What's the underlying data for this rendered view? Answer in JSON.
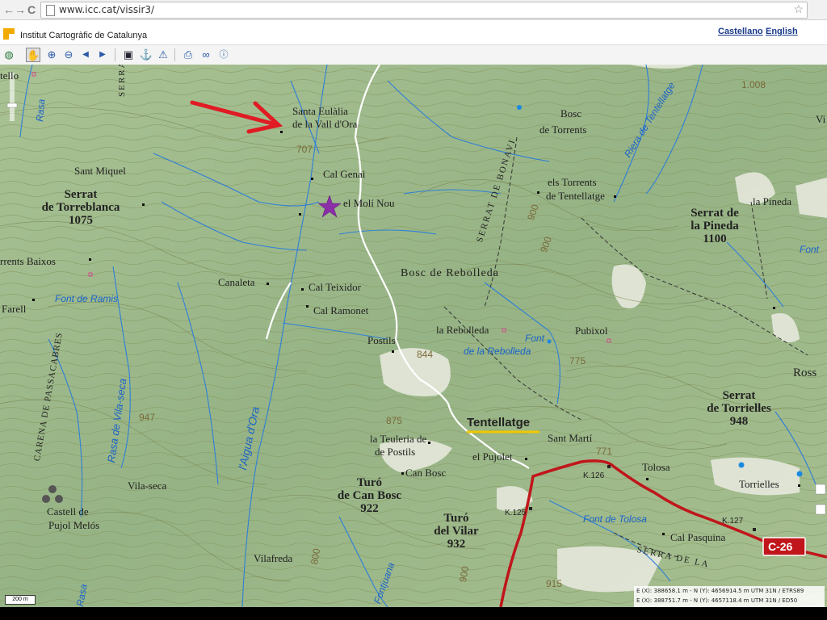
{
  "browser": {
    "back": "←",
    "forward": "→",
    "reload": "C",
    "url": "www.icc.cat/vissir3/",
    "star": "☆"
  },
  "header": {
    "title": "Institut Cartogràfic de Catalunya",
    "lang_es": "Castellano",
    "lang_en": "English"
  },
  "toolbar": {
    "icons": [
      "globe-icon",
      "hand-icon",
      "zoom-in-icon",
      "zoom-out-icon",
      "arrow-left-icon",
      "arrow-right-icon",
      "save-icon",
      "anchor-icon",
      "warning-icon",
      "print-icon",
      "link-icon",
      "help-icon"
    ]
  },
  "map": {
    "labels": {
      "santa_eulalia_1": "Santa Eulàlia",
      "santa_eulalia_2": "de la Vall d'Ora",
      "sant_miquel": "Sant Miquel",
      "serrat_torreblanca_1": "Serrat",
      "serrat_torreblanca_2": "de Torreblanca",
      "serrat_torreblanca_3": "1075",
      "torrents_baixos": "rrents Baixos",
      "farell": "Farell",
      "font_ramis": "Font de Ramis",
      "canaleta": "Canaleta",
      "cal_teixidor": "Cal Teixidor",
      "cal_ramonet": "Cal Ramonet",
      "cal_genai": "Cal Genai",
      "el_moli_nou": "el Molí Nou",
      "bosc_rebolleda": "Bosc de Rebolleda",
      "bosc_torrents_1": "Bosc",
      "bosc_torrents_2": "de Torrents",
      "els_torrents_1": "els Torrents",
      "els_torrents_2": "de Tentellatge",
      "riera_tentellatge": "Riera de Tentellatge",
      "la_pineda": "la Pineda",
      "serrat_pineda_1": "Serrat de",
      "serrat_pineda_2": "la Pineda",
      "serrat_pineda_3": "1100",
      "font_right": "Font",
      "postils": "Postils",
      "la_rebolleda": "la Rebolleda",
      "font_rebolleda_1": "Font",
      "font_rebolleda_2": "de la Rebolleda",
      "pubixol": "Pubixol",
      "tentellatge": "Tentellatge",
      "la_teuleria_1": "la Teuleria de",
      "la_teuleria_2": "de Postils",
      "can_bosc": "Can Bosc",
      "turo_can_bosc_1": "Turó",
      "turo_can_bosc_2": "de Can Bosc",
      "turo_can_bosc_3": "922",
      "turo_vilar_1": "Turó",
      "turo_vilar_2": "del Vilar",
      "turo_vilar_3": "932",
      "el_pujolet": "el Pujolet",
      "sant_marti": "Sant Martí",
      "tolosa": "Tolosa",
      "torrielles": "Torrielles",
      "serrat_torrielles_1": "Serrat",
      "serrat_torrielles_2": "de Torrielles",
      "serrat_torrielles_3": "948",
      "font_tolosa": "Font de Tolosa",
      "cal_pasquina": "Cal Pasquina",
      "vila_seca": "Vila-seca",
      "castell_pujol_1": "Castell de",
      "castell_pujol_2": "Pujol Melós",
      "vilafreda": "Vilafreda",
      "aigua_dora": "l'Aigua d'Ora",
      "rasa_vila_seca": "Rasa de Vila-seca",
      "carena_passacabres": "CARENA DE PASSACABRES",
      "serra_left": "SERRA",
      "serrat_bonavi": "SERRAT DE BONAVI",
      "serra_bottom": "SERRA DE LA",
      "rasa_top": "Rasa",
      "rasa_bottom": "Rasa",
      "fontjuana": "Fontjuana",
      "tello": "tello",
      "vi": "Vi",
      "ross": "Ross",
      "k126": "K.126",
      "k125": "K.125",
      "k127": "K.127",
      "c26": "C-26",
      "alt_707": "707",
      "alt_844": "844",
      "alt_875": "875",
      "alt_947": "947",
      "alt_775": "775",
      "alt_771": "771",
      "alt_900a": "900",
      "alt_900b": "900",
      "alt_900c": "900",
      "alt_800": "800",
      "alt_915": "915",
      "alt_1008": "1.008"
    },
    "scale": "200 m",
    "coords_line1": "E (X): 388658.1 m - N (Y): 4656914.5 m UTM 31N / ETRS89",
    "coords_line2": "E (X): 388751.7 m - N (Y): 4657118.4 m UTM 31N / ED50",
    "colors": {
      "terrain": "#9fb98c",
      "contour": "#7a6a3a",
      "water": "#1a63c9",
      "road": "#c0161b",
      "path": "#ffffff",
      "arrow": "#e01b24",
      "star": "#8b2fa8",
      "highlight": "#f0c800"
    }
  }
}
